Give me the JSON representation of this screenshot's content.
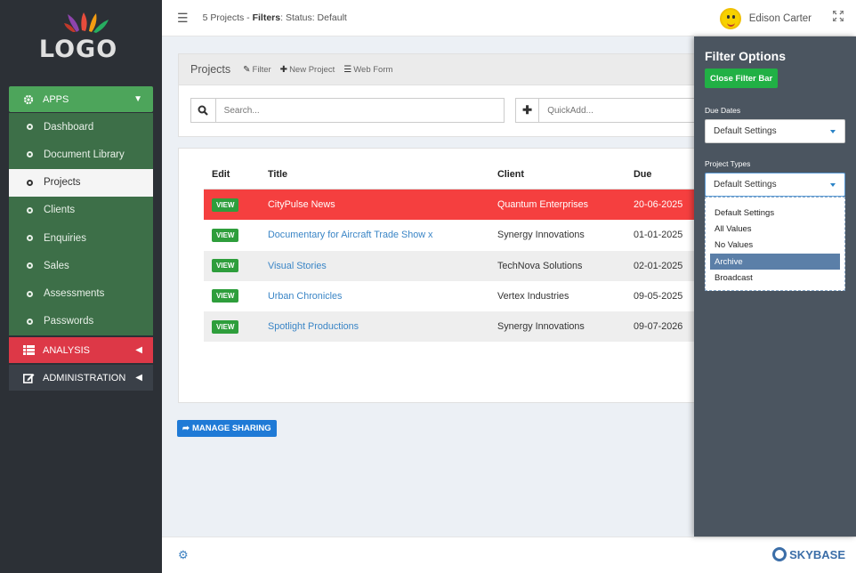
{
  "sidebar": {
    "logo_text": "LOGO",
    "apps": {
      "label": "APPS",
      "icon": "gear-icon"
    },
    "apps_items": [
      {
        "label": "Dashboard"
      },
      {
        "label": "Document Library"
      },
      {
        "label": "Projects",
        "active": true
      },
      {
        "label": "Clients"
      },
      {
        "label": "Enquiries"
      },
      {
        "label": "Sales"
      },
      {
        "label": "Assessments"
      },
      {
        "label": "Passwords"
      }
    ],
    "analysis": {
      "label": "ANALYSIS",
      "icon": "list-icon"
    },
    "administration": {
      "label": "ADMINISTRATION",
      "icon": "edit-icon"
    }
  },
  "topbar": {
    "crumb_prefix": "5 Projects - ",
    "crumb_filters": "Filters",
    "crumb_suffix": ": Status: Default",
    "user_name": "Edison Carter"
  },
  "panel": {
    "title": "Projects",
    "filter_label": "Filter",
    "new_project_label": "New Project",
    "web_form_label": "Web Form"
  },
  "search": {
    "placeholder": "Search...",
    "quickadd_placeholder": "QuickAdd..."
  },
  "table": {
    "headers": {
      "edit": "Edit",
      "title": "Title",
      "client": "Client",
      "due": "Due"
    },
    "view_label": "VIEW",
    "rows": [
      {
        "title": "CityPulse News",
        "client": "Quantum Enterprises",
        "due": "20-06-2025"
      },
      {
        "title": "Documentary for Aircraft Trade Show x",
        "client": "Synergy Innovations",
        "due": "01-01-2025"
      },
      {
        "title": "Visual Stories",
        "client": "TechNova Solutions",
        "due": "02-01-2025"
      },
      {
        "title": "Urban Chronicles",
        "client": "Vertex Industries",
        "due": "09-05-2025"
      },
      {
        "title": "Spotlight Productions",
        "client": "Synergy Innovations",
        "due": "09-07-2026"
      }
    ]
  },
  "share_label": "MANAGE SHARING",
  "footer": {
    "brand": "SKYBASE"
  },
  "filter": {
    "title": "Filter Options",
    "close_label": "Close Filter Bar",
    "due_dates_label": "Due Dates",
    "due_dates_value": "Default Settings",
    "project_types_label": "Project Types",
    "project_types_value": "Default Settings",
    "options": [
      "Default Settings",
      "All Values",
      "No Values",
      "Archive",
      "Broadcast"
    ],
    "selected_option": "Archive"
  }
}
